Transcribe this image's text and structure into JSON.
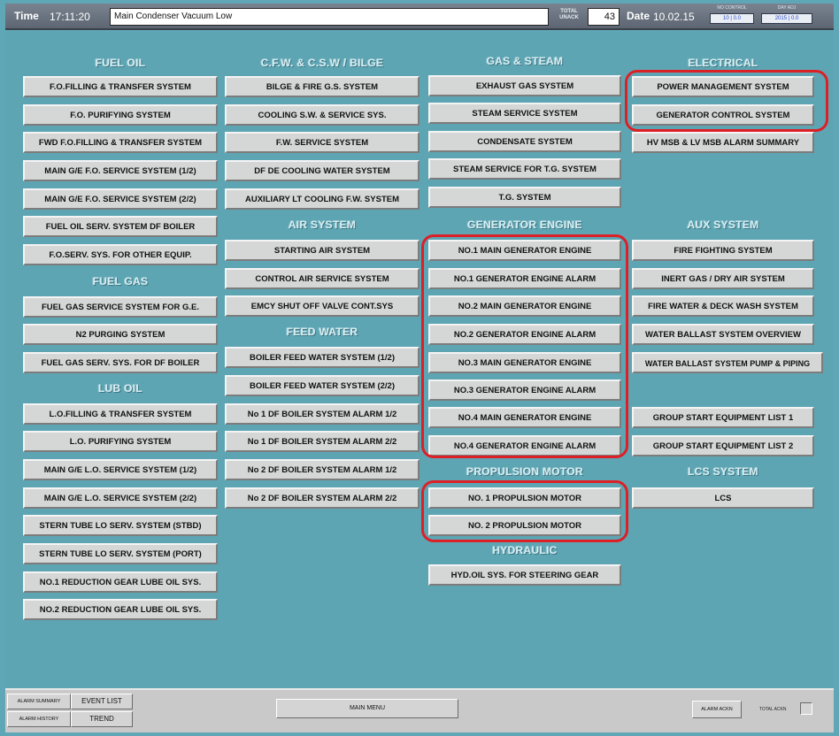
{
  "topbar": {
    "time_label": "Time",
    "time_value": "17:11:20",
    "message": "Main Condenser Vacuum Low",
    "total_label_1": "TOTAL",
    "total_label_2": "UNACK",
    "total_value": "43",
    "date_label": "Date",
    "date_value": "10.02.15",
    "mini_label_1": "NO CONTROL",
    "mini_box_1": "10 | 0.0",
    "mini_label_2": "DAY ADJ",
    "mini_box_2": "2015 | 0.0"
  },
  "sections": {
    "fuel_oil": {
      "title": "FUEL OIL",
      "buttons": [
        "F.O.FILLING & TRANSFER SYSTEM",
        "F.O. PURIFYING SYSTEM",
        "FWD F.O.FILLING & TRANSFER SYSTEM",
        "MAIN G/E F.O. SERVICE SYSTEM (1/2)",
        "MAIN G/E F.O. SERVICE SYSTEM (2/2)",
        "FUEL OIL SERV. SYSTEM DF BOILER",
        "F.O.SERV. SYS. FOR OTHER EQUIP."
      ]
    },
    "fuel_gas": {
      "title": "FUEL GAS",
      "buttons": [
        "FUEL GAS SERVICE SYSTEM FOR G.E.",
        "N2 PURGING SYSTEM",
        "FUEL GAS SERV. SYS. FOR DF BOILER"
      ]
    },
    "lub_oil": {
      "title": "LUB OIL",
      "buttons": [
        "L.O.FILLING & TRANSFER SYSTEM",
        "L.O. PURIFYING SYSTEM",
        "MAIN G/E L.O. SERVICE SYSTEM (1/2)",
        "MAIN G/E L.O. SERVICE SYSTEM (2/2)",
        "STERN TUBE LO SERV. SYSTEM (STBD)",
        "STERN TUBE LO SERV. SYSTEM (PORT)",
        "NO.1 REDUCTION GEAR LUBE OIL SYS.",
        "NO.2 REDUCTION GEAR LUBE OIL SYS."
      ]
    },
    "cfw": {
      "title": "C.F.W. & C.S.W / BILGE",
      "buttons": [
        "BILGE & FIRE G.S. SYSTEM",
        "COOLING S.W. & SERVICE SYS.",
        "F.W. SERVICE SYSTEM",
        "DF DE COOLING WATER SYSTEM",
        "AUXILIARY LT COOLING F.W. SYSTEM"
      ]
    },
    "air_system": {
      "title": "AIR SYSTEM",
      "buttons": [
        "STARTING AIR SYSTEM",
        "CONTROL AIR SERVICE SYSTEM",
        "EMCY SHUT OFF VALVE CONT.SYS"
      ]
    },
    "feed_water": {
      "title": "FEED WATER",
      "buttons": [
        "BOILER FEED WATER SYSTEM (1/2)",
        "BOILER FEED WATER SYSTEM (2/2)",
        "No 1 DF BOILER SYSTEM ALARM 1/2",
        "No 1 DF BOILER SYSTEM ALARM 2/2",
        "No 2 DF BOILER SYSTEM ALARM 1/2",
        "No 2 DF BOILER SYSTEM ALARM 2/2"
      ]
    },
    "gas_steam": {
      "title": "GAS & STEAM",
      "buttons": [
        "EXHAUST GAS SYSTEM",
        "STEAM SERVICE SYSTEM",
        "CONDENSATE SYSTEM",
        "STEAM SERVICE FOR T.G. SYSTEM",
        "T.G. SYSTEM"
      ]
    },
    "generator_engine": {
      "title": "GENERATOR ENGINE",
      "buttons": [
        "NO.1 MAIN GENERATOR ENGINE",
        "NO.1 GENERATOR ENGINE ALARM",
        "NO.2 MAIN GENERATOR ENGINE",
        "NO.2 GENERATOR ENGINE ALARM",
        "NO.3 MAIN GENERATOR ENGINE",
        "NO.3 GENERATOR ENGINE ALARM",
        "NO.4 MAIN GENERATOR ENGINE",
        "NO.4 GENERATOR ENGINE ALARM"
      ]
    },
    "propulsion_motor": {
      "title": "PROPULSION MOTOR",
      "buttons": [
        "NO. 1 PROPULSION MOTOR",
        "NO. 2 PROPULSION MOTOR"
      ]
    },
    "hydraulic": {
      "title": "HYDRAULIC",
      "buttons": [
        "HYD.OIL SYS. FOR STEERING GEAR"
      ]
    },
    "electrical": {
      "title": "ELECTRICAL",
      "buttons": [
        "POWER MANAGEMENT SYSTEM",
        "GENERATOR CONTROL SYSTEM",
        "HV MSB & LV MSB ALARM SUMMARY"
      ]
    },
    "aux_system": {
      "title": "AUX SYSTEM",
      "buttons": [
        "FIRE FIGHTING SYSTEM",
        "INERT GAS / DRY AIR SYSTEM",
        "FIRE WATER & DECK WASH SYSTEM",
        "WATER BALLAST SYSTEM OVERVIEW",
        "WATER BALLAST SYSTEM PUMP & PIPING",
        "GROUP START EQUIPMENT LIST 1",
        "GROUP START EQUIPMENT LIST 2"
      ]
    },
    "lcs_system": {
      "title": "LCS SYSTEM",
      "buttons": [
        "LCS"
      ]
    }
  },
  "bottombar": {
    "alarm_summary": "ALARM SUMMARY",
    "alarm_history": "ALARM HISTORY",
    "event_list": "EVENT LIST",
    "trend": "TREND",
    "main_menu": "MAIN MENU",
    "alarm_ack": "ALARM ACKN",
    "total_ackn": "TOTAL ACKN"
  },
  "colors": {
    "background": "#5fa6b6",
    "button": "#d5d6d6",
    "highlight": "#dd1f26",
    "topbar": "#6b7480"
  }
}
